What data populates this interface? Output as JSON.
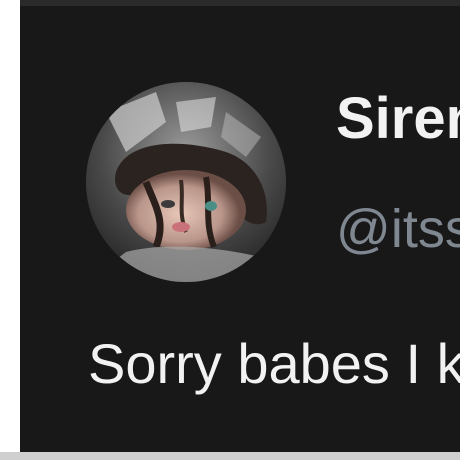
{
  "tweet": {
    "display_name": "Siren",
    "handle": "@itss",
    "text": "Sorry babes I k"
  },
  "avatar": {
    "icon": "profile-photo"
  },
  "colors": {
    "background": "#181818",
    "name": "#f2f2f2",
    "handle": "#7f8790",
    "text": "#f2f2f2"
  }
}
